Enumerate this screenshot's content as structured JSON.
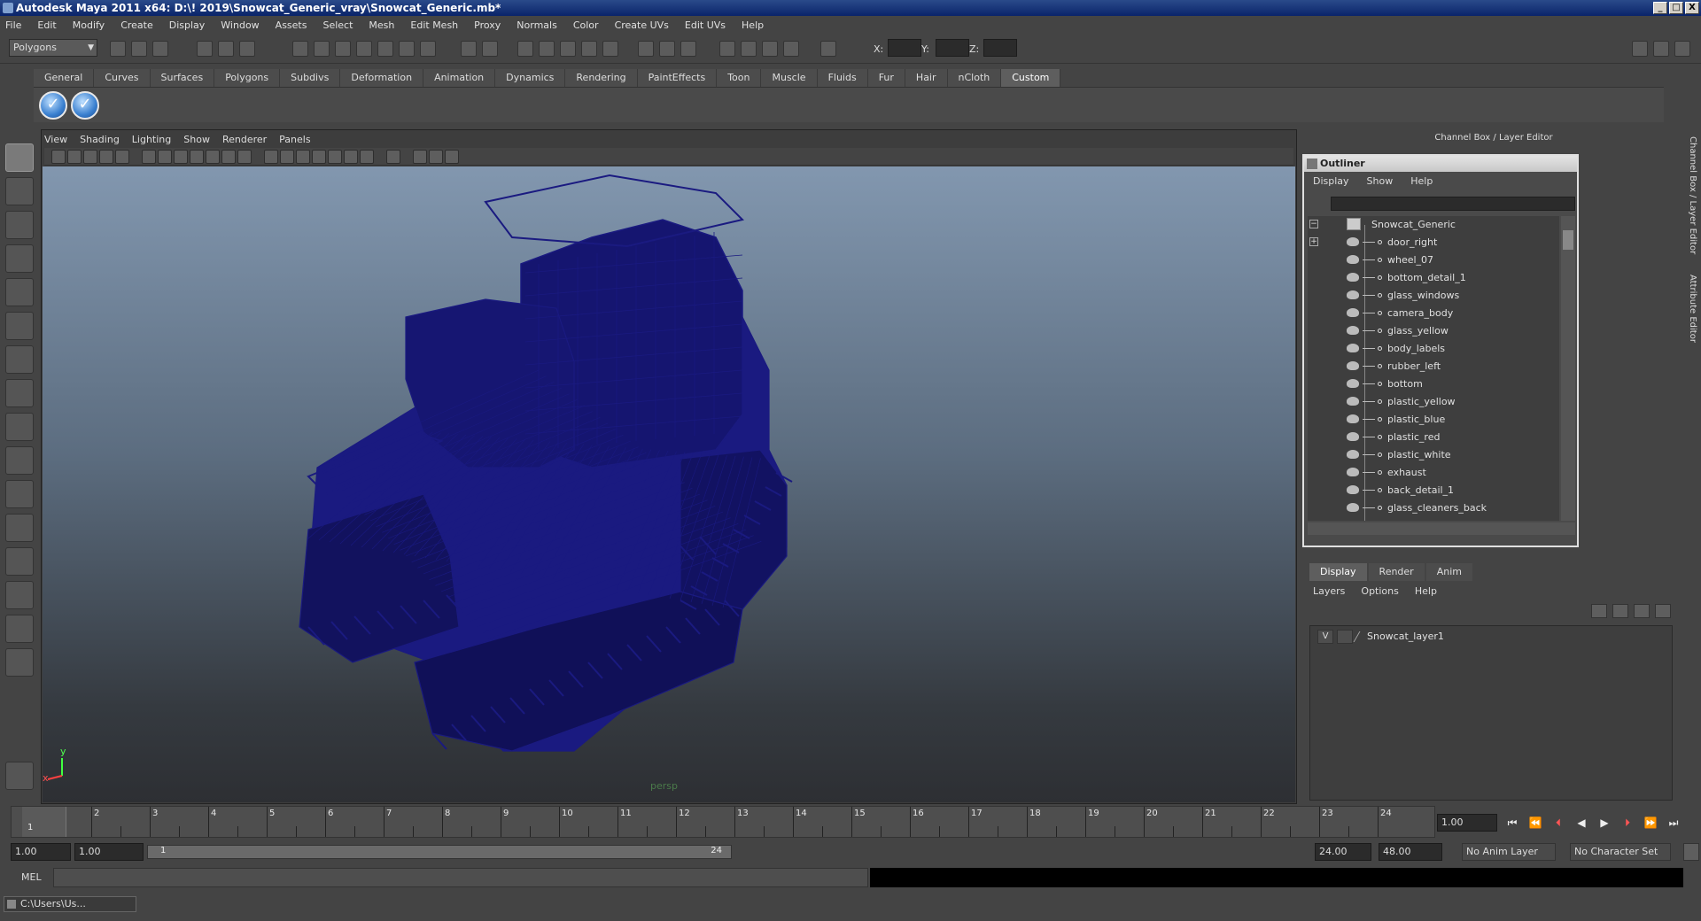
{
  "window": {
    "title": "Autodesk Maya 2011 x64: D:\\! 2019\\Snowcat_Generic_vray\\Snowcat_Generic.mb*",
    "btn_min": "_",
    "btn_max": "□",
    "btn_close": "X"
  },
  "menu": [
    "File",
    "Edit",
    "Modify",
    "Create",
    "Display",
    "Window",
    "Assets",
    "Select",
    "Mesh",
    "Edit Mesh",
    "Proxy",
    "Normals",
    "Color",
    "Create UVs",
    "Edit UVs",
    "Help"
  ],
  "status": {
    "mode": "Polygons",
    "x_label": "X:",
    "y_label": "Y:",
    "z_label": "Z:"
  },
  "shelf_tabs": [
    "General",
    "Curves",
    "Surfaces",
    "Polygons",
    "Subdivs",
    "Deformation",
    "Animation",
    "Dynamics",
    "Rendering",
    "PaintEffects",
    "Toon",
    "Muscle",
    "Fluids",
    "Fur",
    "Hair",
    "nCloth",
    "Custom"
  ],
  "active_shelf_tab": "Custom",
  "viewport": {
    "menu": [
      "View",
      "Shading",
      "Lighting",
      "Show",
      "Renderer",
      "Panels"
    ],
    "camera_label": "persp",
    "wire_color": "#1a1a80",
    "axis_x": "x",
    "axis_y": "y"
  },
  "right_panel": {
    "header": "Channel Box / Layer Editor",
    "vtab_channel": "Channel Box / Layer Editor",
    "vtab_attribute": "Attribute Editor"
  },
  "outliner": {
    "title": "Outliner",
    "menu": [
      "Display",
      "Show",
      "Help"
    ],
    "root": "Snowcat_Generic",
    "items": [
      "door_right",
      "wheel_07",
      "bottom_detail_1",
      "glass_windows",
      "camera_body",
      "glass_yellow",
      "body_labels",
      "rubber_left",
      "bottom",
      "plastic_yellow",
      "plastic_blue",
      "plastic_red",
      "plastic_white",
      "exhaust",
      "back_detail_1",
      "glass_cleaners_back"
    ]
  },
  "layers": {
    "tabs": [
      "Display",
      "Render",
      "Anim"
    ],
    "active_tab": "Display",
    "menu": [
      "Layers",
      "Options",
      "Help"
    ],
    "rows": [
      {
        "visible": "V",
        "name": "Snowcat_layer1"
      }
    ]
  },
  "timeline": {
    "ticks": [
      "1",
      "2",
      "3",
      "4",
      "5",
      "6",
      "7",
      "8",
      "9",
      "10",
      "11",
      "12",
      "13",
      "14",
      "15",
      "16",
      "17",
      "18",
      "19",
      "20",
      "21",
      "22",
      "23",
      "24"
    ],
    "current_frame_marker": "1",
    "current_frame": "1.00"
  },
  "range": {
    "start": "1.00",
    "playback_start": "1.00",
    "slider_start": "1",
    "slider_end": "24",
    "playback_end": "24.00",
    "end": "48.00",
    "anim_layer": "No Anim Layer",
    "char_set": "No Character Set"
  },
  "cmdline": {
    "label": "MEL"
  },
  "taskbar": {
    "item": "C:\\Users\\Us..."
  }
}
